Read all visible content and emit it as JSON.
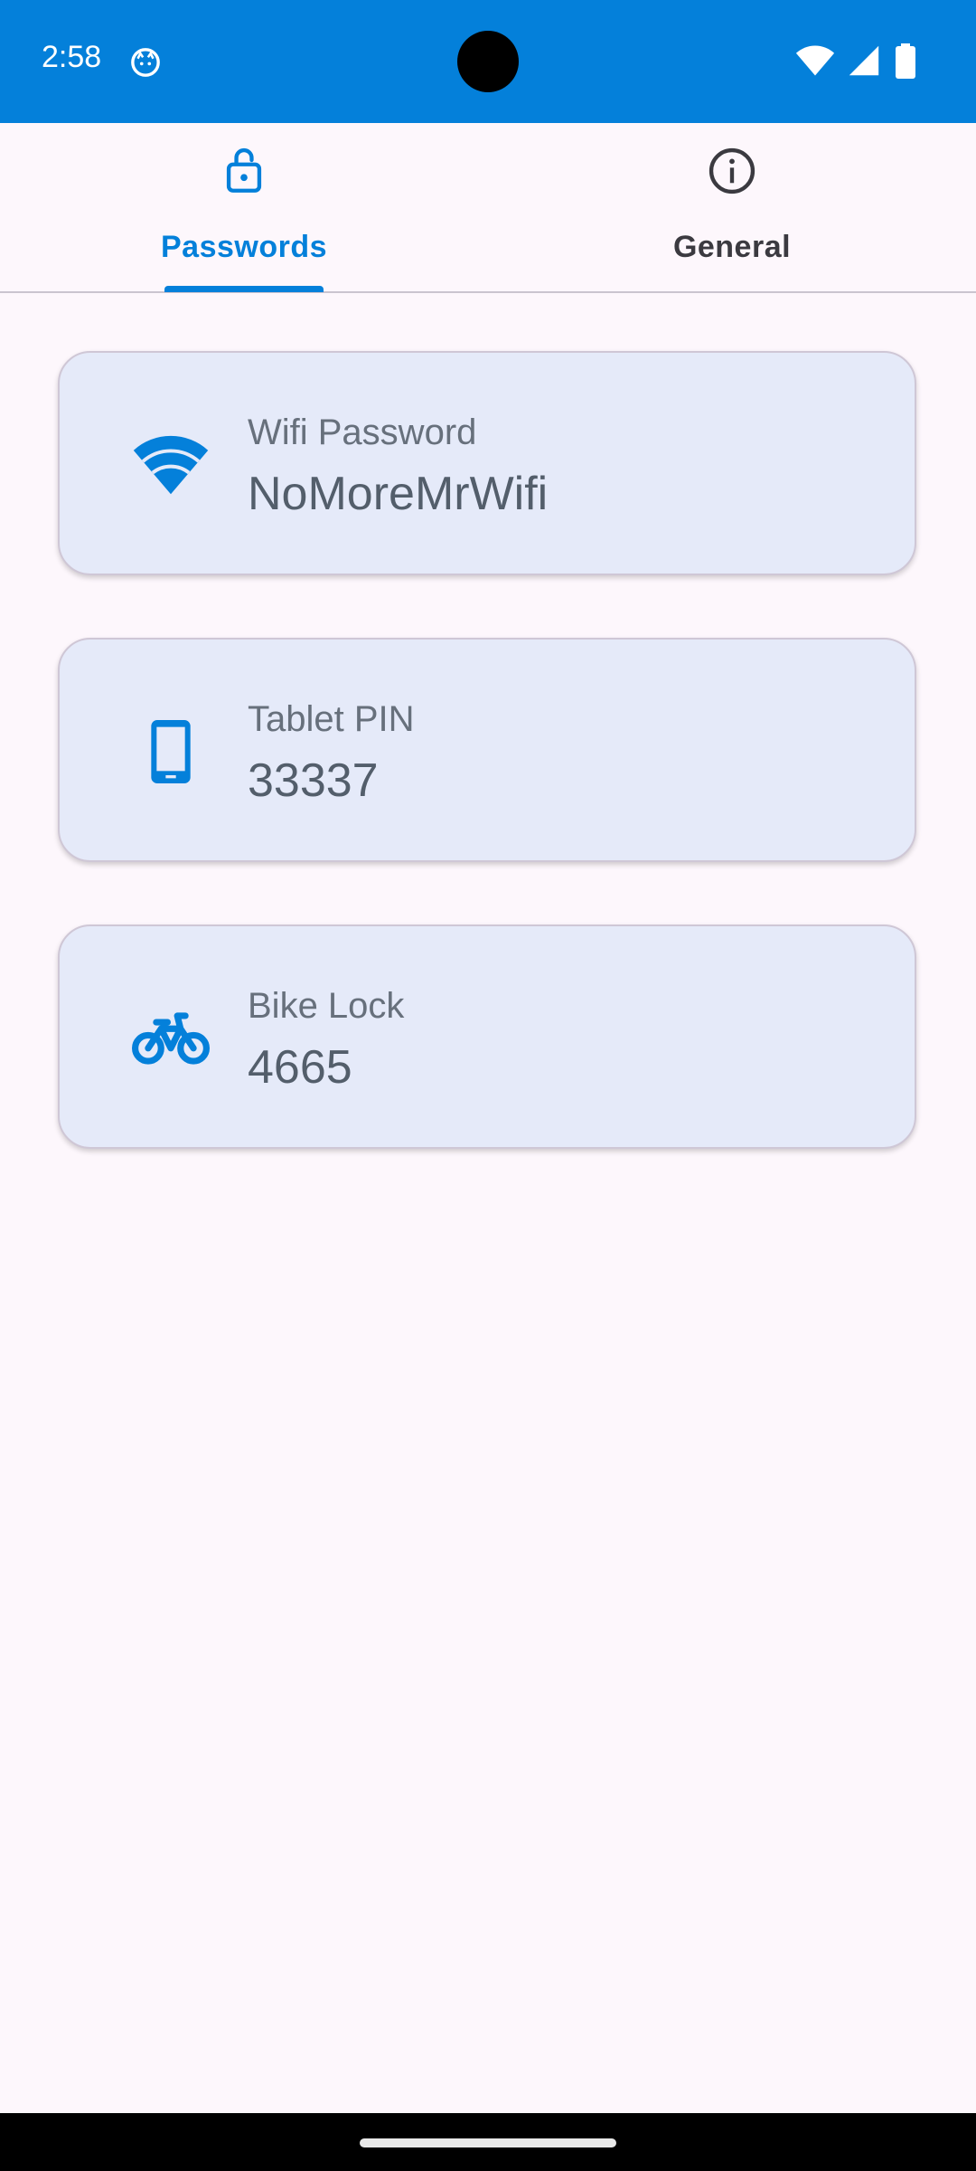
{
  "status_bar": {
    "time": "2:58",
    "icons": [
      "app-notification-icon",
      "wifi-icon",
      "signal-icon",
      "battery-icon"
    ]
  },
  "tabs": [
    {
      "label": "Passwords",
      "icon": "lock-open-icon",
      "selected": true
    },
    {
      "label": "General",
      "icon": "info-icon",
      "selected": false
    }
  ],
  "cards": [
    {
      "label": "Wifi Password",
      "value": "NoMoreMrWifi",
      "icon": "wifi-icon"
    },
    {
      "label": "Tablet PIN",
      "value": "33337",
      "icon": "tablet-icon"
    },
    {
      "label": "Bike Lock",
      "value": "4665",
      "icon": "bike-icon"
    }
  ],
  "colors": {
    "accent": "#0480DA",
    "background": "#FDF7FC",
    "card": "#E5EAF9"
  }
}
